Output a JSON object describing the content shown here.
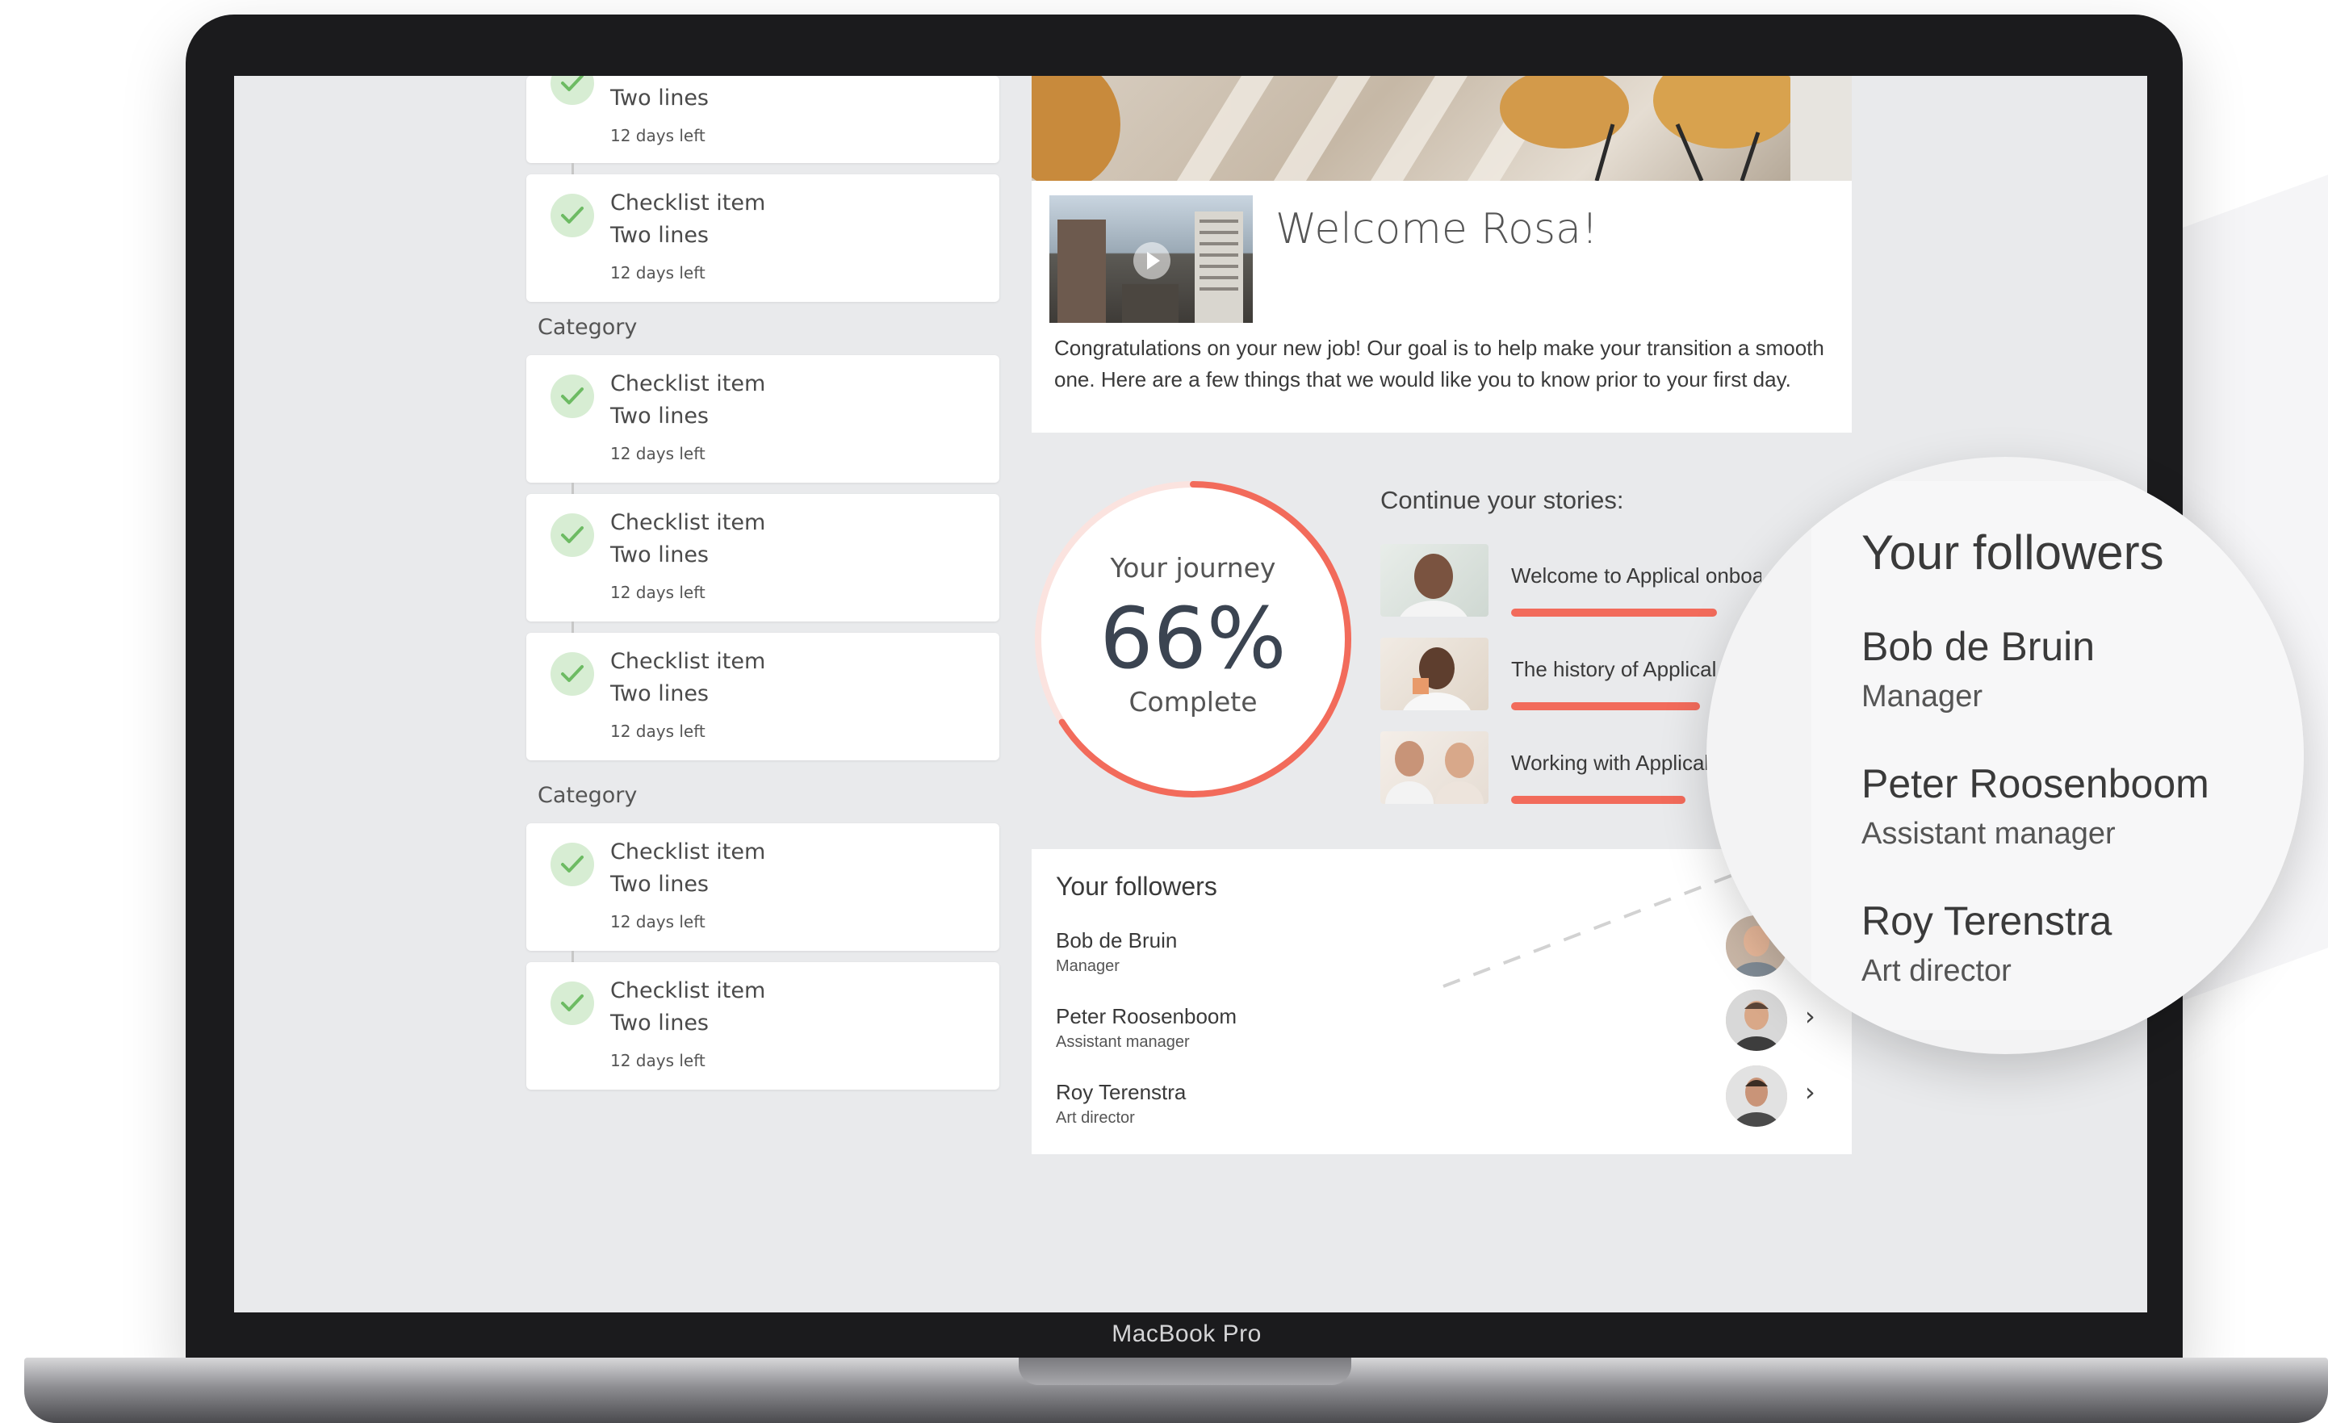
{
  "device": {
    "brand_label": "MacBook Pro"
  },
  "checklist": {
    "partial_item": {
      "subtitle": "Two lines",
      "days": "12 days left"
    },
    "items_top": [
      {
        "title": "Checklist item",
        "subtitle": "Two lines",
        "days": "12 days left"
      }
    ],
    "categories": [
      {
        "label": "Category",
        "items": [
          {
            "title": "Checklist item",
            "subtitle": "Two lines",
            "days": "12 days left"
          },
          {
            "title": "Checklist item",
            "subtitle": "Two lines",
            "days": "12 days left"
          },
          {
            "title": "Checklist item",
            "subtitle": "Two lines",
            "days": "12 days left"
          }
        ]
      },
      {
        "label": "Category",
        "items": [
          {
            "title": "Checklist item",
            "subtitle": "Two lines",
            "days": "12 days left"
          },
          {
            "title": "Checklist item",
            "subtitle": "Two lines",
            "days": "12 days left"
          }
        ]
      }
    ]
  },
  "welcome": {
    "title": "Welcome Rosa!",
    "body": "Congratulations on your new job! Our goal is to help make your transition a smooth one. Here are a few things that we would like you to know prior to your first day."
  },
  "journey": {
    "label": "Your journey",
    "percent_text": "66%",
    "percent_value": 66,
    "status": "Complete",
    "accent_color": "#f26b5b"
  },
  "stories": {
    "title": "Continue your stories:",
    "items": [
      {
        "title": "Welcome to Applical onboarding",
        "progress": 0.85
      },
      {
        "title": "The history of Applical",
        "progress": 0.78
      },
      {
        "title": "Working with Applical",
        "progress": 0.72
      }
    ]
  },
  "followers": {
    "title": "Your followers",
    "items": [
      {
        "name": "Bob de Bruin",
        "role": "Manager"
      },
      {
        "name": "Peter Roosenboom",
        "role": "Assistant manager"
      },
      {
        "name": "Roy Terenstra",
        "role": "Art director"
      }
    ],
    "chevron": "›"
  },
  "magnifier": {
    "title": "Your followers",
    "items": [
      {
        "name": "Bob de Bruin",
        "role": "Manager"
      },
      {
        "name": "Peter Roosenboom",
        "role": "Assistant manager"
      },
      {
        "name": "Roy Terenstra",
        "role": "Art director"
      }
    ]
  },
  "icons": {
    "check": "check-icon",
    "play": "play-icon",
    "chevron": "chevron-right-icon"
  },
  "colors": {
    "accent": "#f26b5b",
    "check_bg": "#d7edd3",
    "check_mark": "#6dbb63",
    "screen_bg": "#e9eaec"
  }
}
